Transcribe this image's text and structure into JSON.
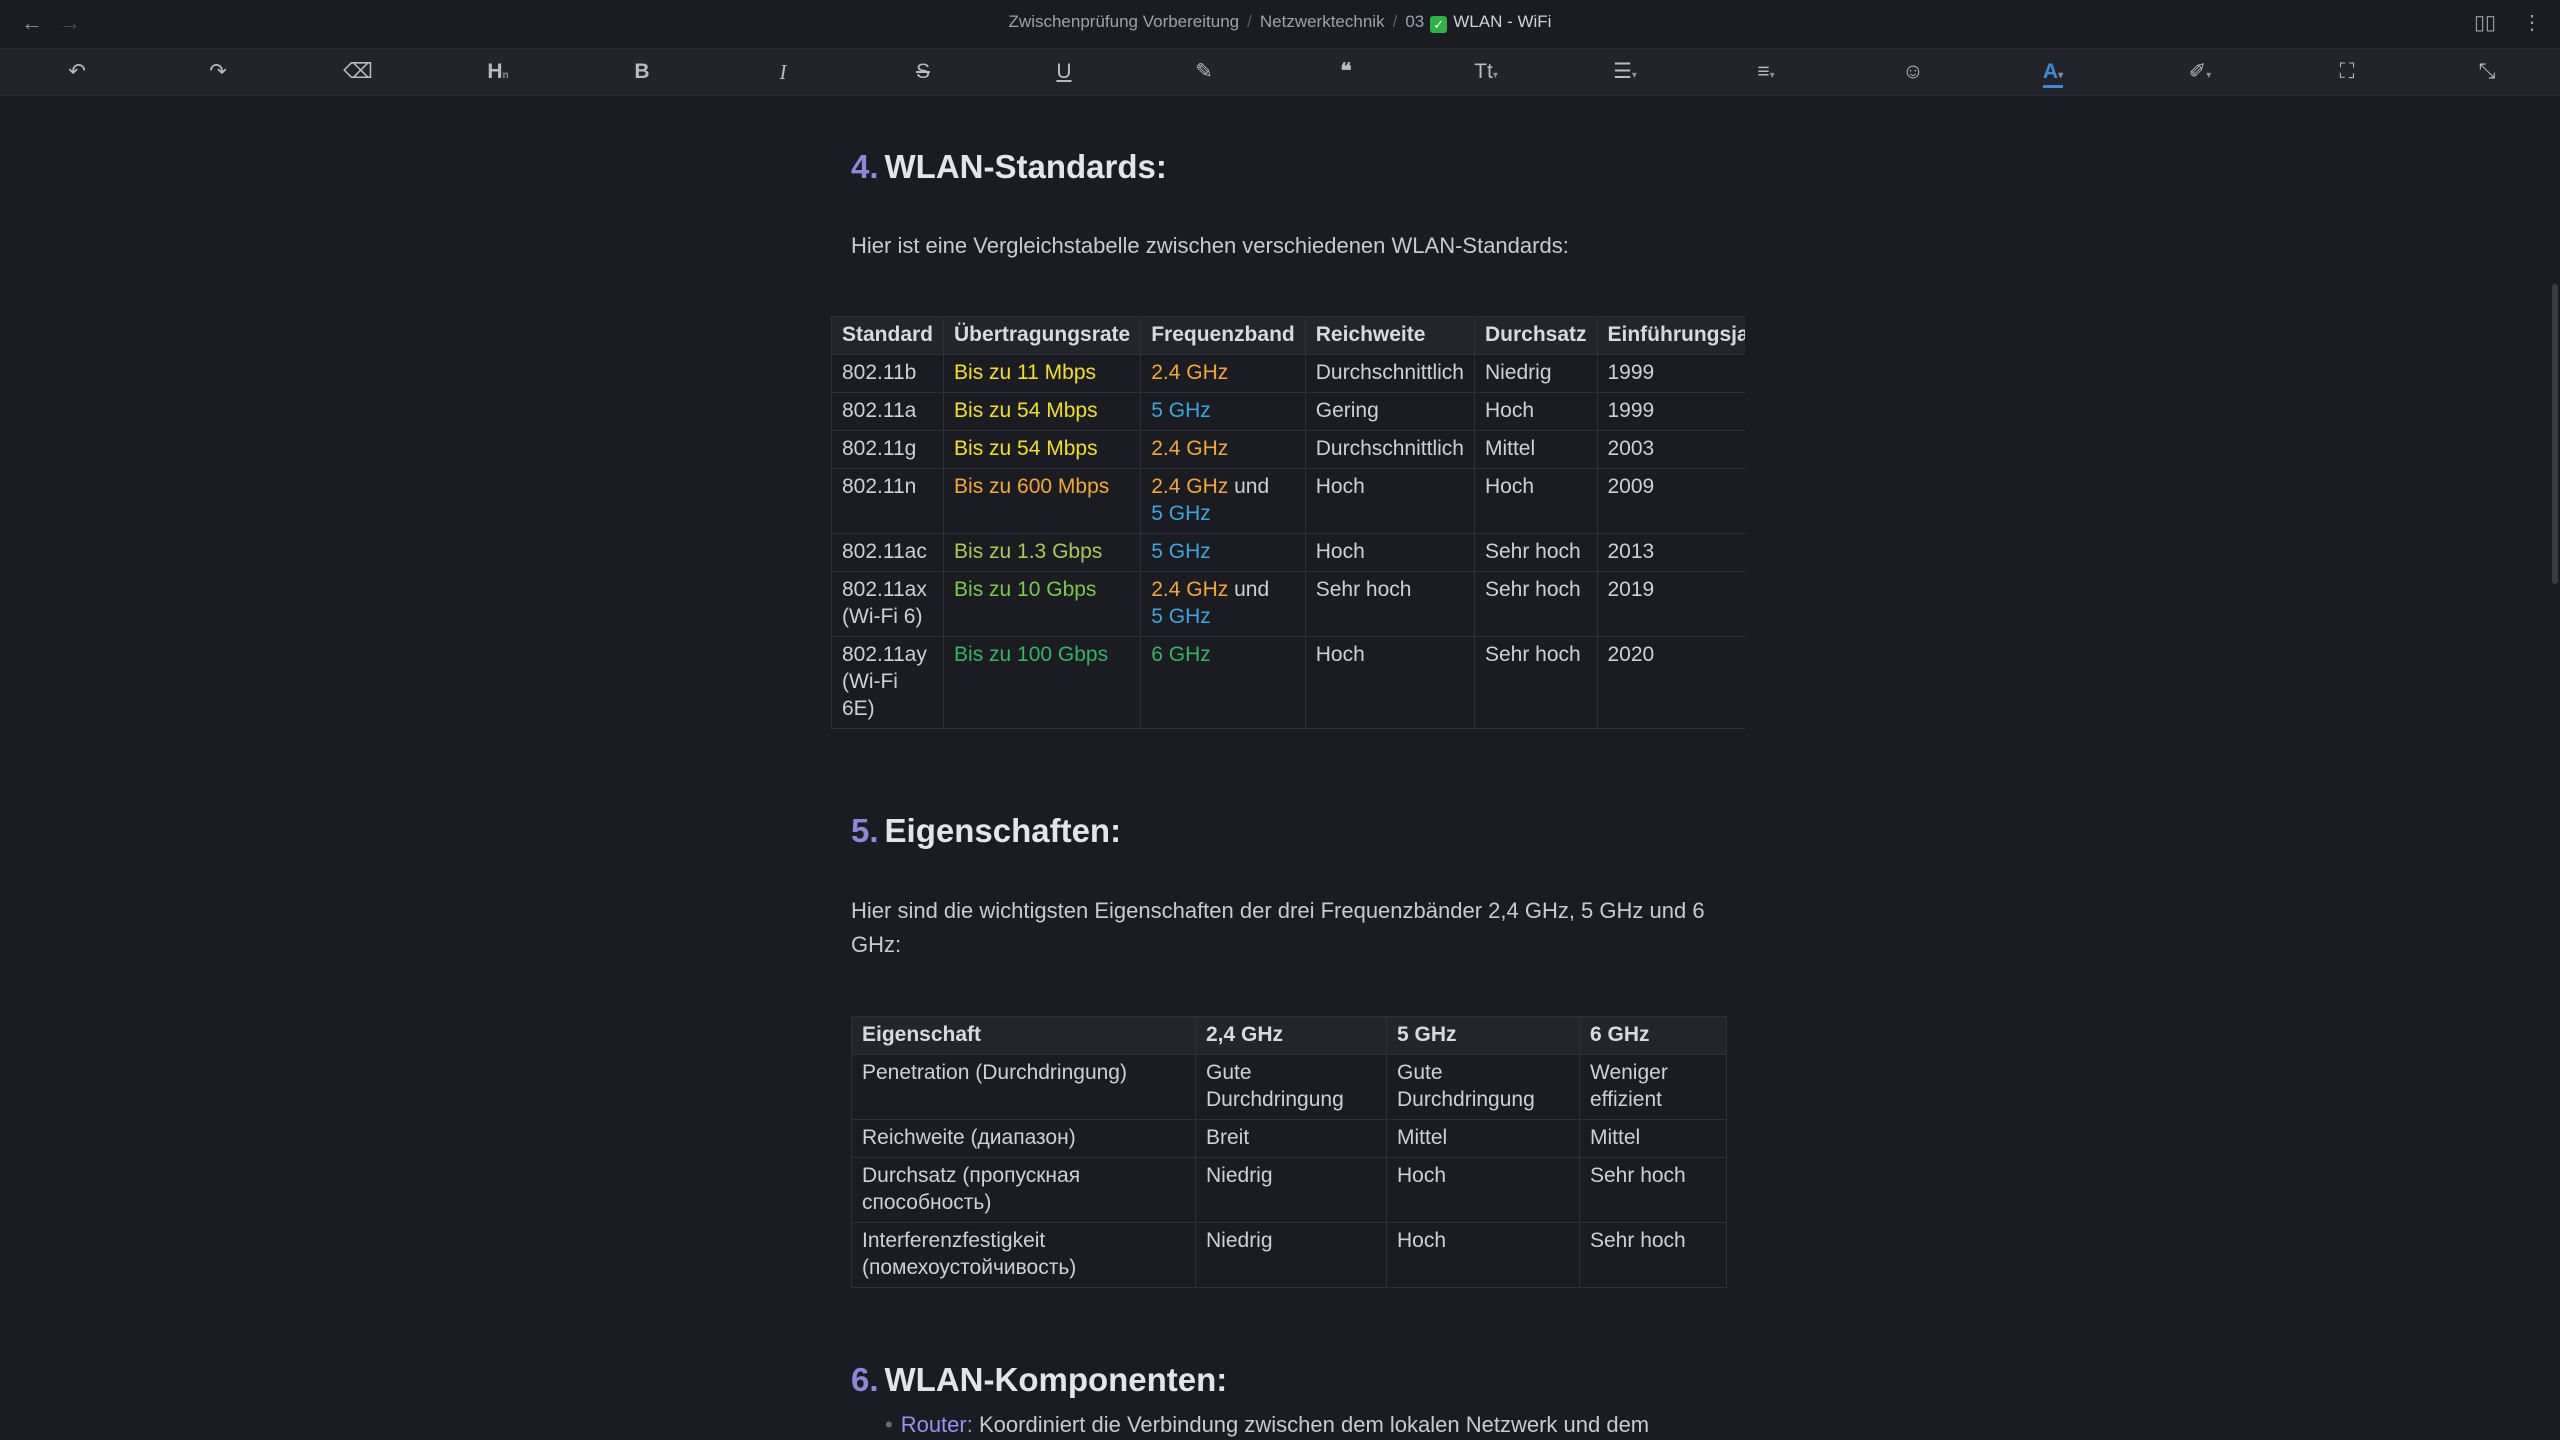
{
  "titlebar": {
    "breadcrumb": [
      "Zwischenprüfung Vorbereitung",
      "Netzwerktechnik",
      "03"
    ],
    "current_title": "WLAN - WiFi"
  },
  "toolbar": {
    "icons": [
      "undo-icon",
      "redo-icon",
      "eraser-icon",
      "heading-icon",
      "bold-icon",
      "italic-icon",
      "strikethrough-icon",
      "underline-icon",
      "highlight-pen-icon",
      "quote-icon",
      "font-size-icon",
      "list-icon",
      "align-icon",
      "emoji-icon",
      "text-color-icon",
      "background-color-icon",
      "fullscreen-icon",
      "collapse-icon"
    ],
    "accent": "#3a8bd9"
  },
  "sections": {
    "s4": {
      "num": "4.",
      "title": "WLAN-Standards:",
      "intro": "Hier ist eine Vergleichstabelle zwischen verschiedenen WLAN-Standards:",
      "headers": [
        "Standard",
        "Übertragungsrate",
        "Frequenzband",
        "Reichweite",
        "Durchsatz",
        "Einführungsjahr"
      ],
      "rows": [
        {
          "standard": "802.11b",
          "rate": "Bis zu 11 Mbps",
          "band": "2.4 GHz",
          "band2": "",
          "range": "Durchschnittlich",
          "throughput": "Niedrig",
          "year": "1999"
        },
        {
          "standard": "802.11a",
          "rate": "Bis zu 54 Mbps",
          "band": "5 GHz",
          "band2": "",
          "range": "Gering",
          "throughput": "Hoch",
          "year": "1999"
        },
        {
          "standard": "802.11g",
          "rate": "Bis zu 54 Mbps",
          "band": "2.4 GHz",
          "band2": "",
          "range": "Durchschnittlich",
          "throughput": "Mittel",
          "year": "2003"
        },
        {
          "standard": "802.11n",
          "rate": "Bis zu 600 Mbps",
          "band": "2.4 GHz",
          "band2": "5 GHz",
          "range": "Hoch",
          "throughput": "Hoch",
          "year": "2009"
        },
        {
          "standard": "802.11ac",
          "rate": "Bis zu 1.3 Gbps",
          "band": "5 GHz",
          "band2": "",
          "range": "Hoch",
          "throughput": "Sehr hoch",
          "year": "2013"
        },
        {
          "standard": "802.11ax (Wi-Fi 6)",
          "rate": "Bis zu 10 Gbps",
          "band": "2.4 GHz",
          "band2": "5 GHz",
          "range": "Sehr hoch",
          "throughput": "Sehr hoch",
          "year": "2019"
        },
        {
          "standard": "802.11ay (Wi-Fi 6E)",
          "rate": "Bis zu 100 Gbps",
          "band": "6 GHz",
          "band2": "",
          "range": "Hoch",
          "throughput": "Sehr hoch",
          "year": "2020"
        }
      ],
      "und": "und"
    },
    "s5": {
      "num": "5.",
      "title": "Eigenschaften:",
      "intro": "Hier sind die wichtigsten Eigenschaften der drei Frequenzbänder 2,4 GHz, 5 GHz und 6 GHz:",
      "headers": [
        "Eigenschaft",
        "2,4 GHz",
        "5 GHz",
        "6 GHz"
      ],
      "rows": [
        [
          "Penetration (Durchdringung)",
          "Gute Durchdringung",
          "Gute Durchdringung",
          "Weniger effizient"
        ],
        [
          "Reichweite (диапазон)",
          "Breit",
          "Mittel",
          "Mittel"
        ],
        [
          "Durchsatz (пропускная способность)",
          "Niedrig",
          "Hoch",
          "Sehr hoch"
        ],
        [
          "Interferenzfestigkeit (помехоустойчивость)",
          "Niedrig",
          "Hoch",
          "Sehr hoch"
        ]
      ]
    },
    "s6": {
      "num": "6.",
      "title": "WLAN-Komponenten:",
      "item_label": "Router:",
      "item_text": "Koordiniert die Verbindung zwischen dem lokalen Netzwerk und dem"
    }
  }
}
